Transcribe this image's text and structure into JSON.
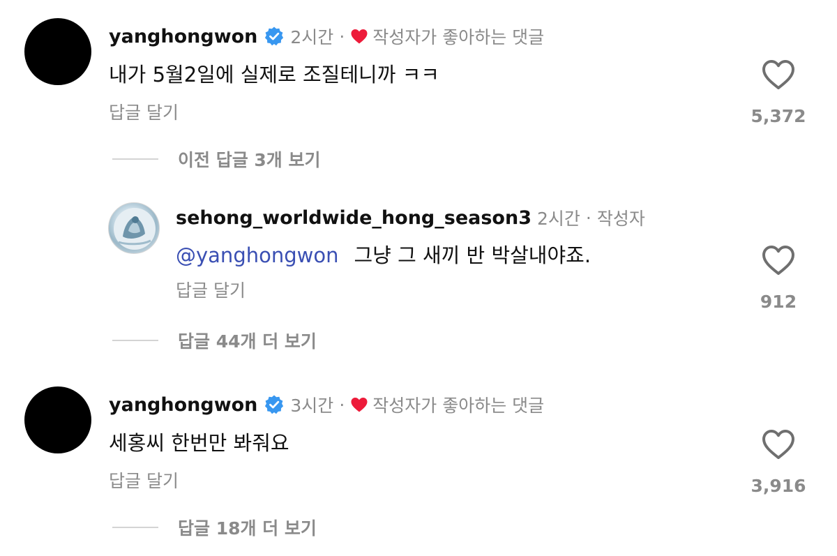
{
  "colors": {
    "verified": "#3897f0",
    "liked_heart": "#ed1b3a",
    "mention": "#3a4fb3",
    "secondary_text": "#8a8a8a"
  },
  "comments": [
    {
      "username": "yanghongwon",
      "verified": true,
      "time": "2시간",
      "separator": "·",
      "liked_label": "작성자가 좋아하는 댓글",
      "text": "내가 5월2일에 실제로 조질테니까 ㅋㅋ",
      "reply_label": "답글 달기",
      "like_count": "5,372",
      "view_replies_label": "이전 답글 3개 보기"
    },
    {
      "username": "sehong_worldwide_hong_season3",
      "time": "2시간",
      "separator": "·",
      "author_label": "작성자",
      "mention": "@yanghongwon",
      "text": "그냥 그 새끼 반 박살내야죠.",
      "reply_label": "답글 달기",
      "like_count": "912",
      "view_replies_label": "답글 44개 더 보기"
    },
    {
      "username": "yanghongwon",
      "verified": true,
      "time": "3시간",
      "separator": "·",
      "liked_label": "작성자가 좋아하는 댓글",
      "text": "세홍씨 한번만 봐줘요",
      "reply_label": "답글 달기",
      "like_count": "3,916",
      "view_replies_label": "답글 18개 더 보기"
    }
  ],
  "icons": {
    "verified": "verified-badge-icon",
    "liked": "heart-filled-icon",
    "like_button": "heart-outline-icon"
  }
}
